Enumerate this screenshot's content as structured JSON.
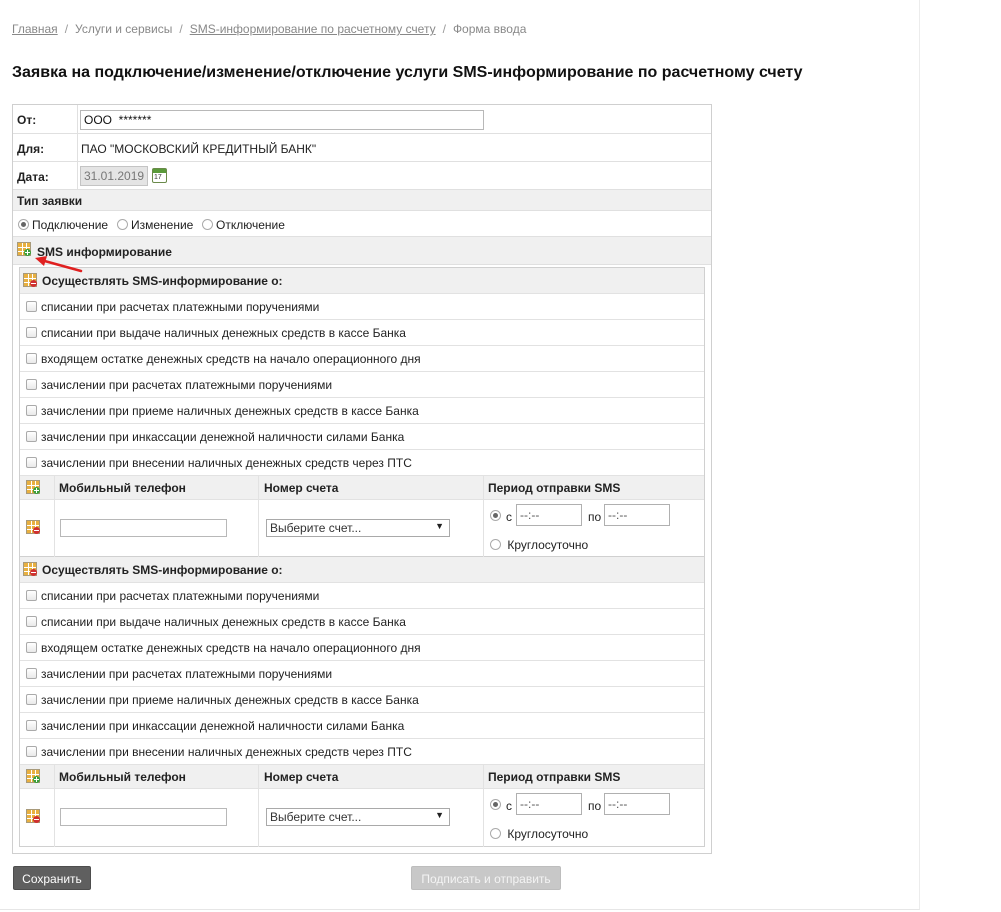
{
  "breadcrumb": {
    "items": [
      "Главная",
      "Услуги и сервисы",
      "SMS-информирование по расчетному счету",
      "Форма ввода"
    ],
    "separator": "/"
  },
  "page_title": "Заявка на подключение/изменение/отключение услуги SMS-информирование по расчетному счету",
  "form": {
    "from_label": "От:",
    "from_value": "ООО  *******",
    "for_label": "Для:",
    "for_value": "ПАО \"МОСКОВСКИЙ КРЕДИТНЫЙ БАНК\"",
    "date_label": "Дата:",
    "date_value": "31.01.2019",
    "calendar_day": "17",
    "request_type_label": "Тип заявки",
    "request_types": [
      "Подключение",
      "Изменение",
      "Отключение"
    ],
    "request_type_selected": "Подключение",
    "sms_section_label": "SMS информирование",
    "blocks": [
      {
        "header": "Осуществлять SMS-информирование о:",
        "options": [
          "списании при расчетах платежными поручениями",
          "списании при выдаче наличных денежных средств в кассе Банка",
          "входящем остатке денежных средств на начало операционного дня",
          "зачислении при расчетах платежными поручениями",
          "зачислении при приеме наличных денежных средств в кассе Банка",
          "зачислении при инкассации денежной наличности силами Банка",
          "зачислении при внесении наличных денежных средств через ПТС"
        ],
        "columns": {
          "phone": "Мобильный телефон",
          "account": "Номер счета",
          "period": "Период отправки SMS"
        },
        "account_select": "Выберите счет...",
        "period_from_label": "с",
        "period_to_label": "по",
        "time_from": "--:--",
        "time_to": "--:--",
        "round_the_clock": "Круглосуточно"
      },
      {
        "header": "Осуществлять SMS-информирование о:",
        "options": [
          "списании при расчетах платежными поручениями",
          "списании при выдаче наличных денежных средств в кассе Банка",
          "входящем остатке денежных средств на начало операционного дня",
          "зачислении при расчетах платежными поручениями",
          "зачислении при приеме наличных денежных средств в кассе Банка",
          "зачислении при инкассации денежной наличности силами Банка",
          "зачислении при внесении наличных денежных средств через ПТС"
        ],
        "columns": {
          "phone": "Мобильный телефон",
          "account": "Номер счета",
          "period": "Период отправки SMS"
        },
        "account_select": "Выберите счет...",
        "period_from_label": "с",
        "period_to_label": "по",
        "time_from": "--:--",
        "time_to": "--:--",
        "round_the_clock": "Круглосуточно"
      }
    ]
  },
  "buttons": {
    "save": "Сохранить",
    "sign_send": "Подписать и отправить"
  },
  "colors": {
    "annotation_arrow": "#e02020",
    "save_button": "#5f5f5f",
    "sign_button_disabled": "#c8c8c8"
  }
}
